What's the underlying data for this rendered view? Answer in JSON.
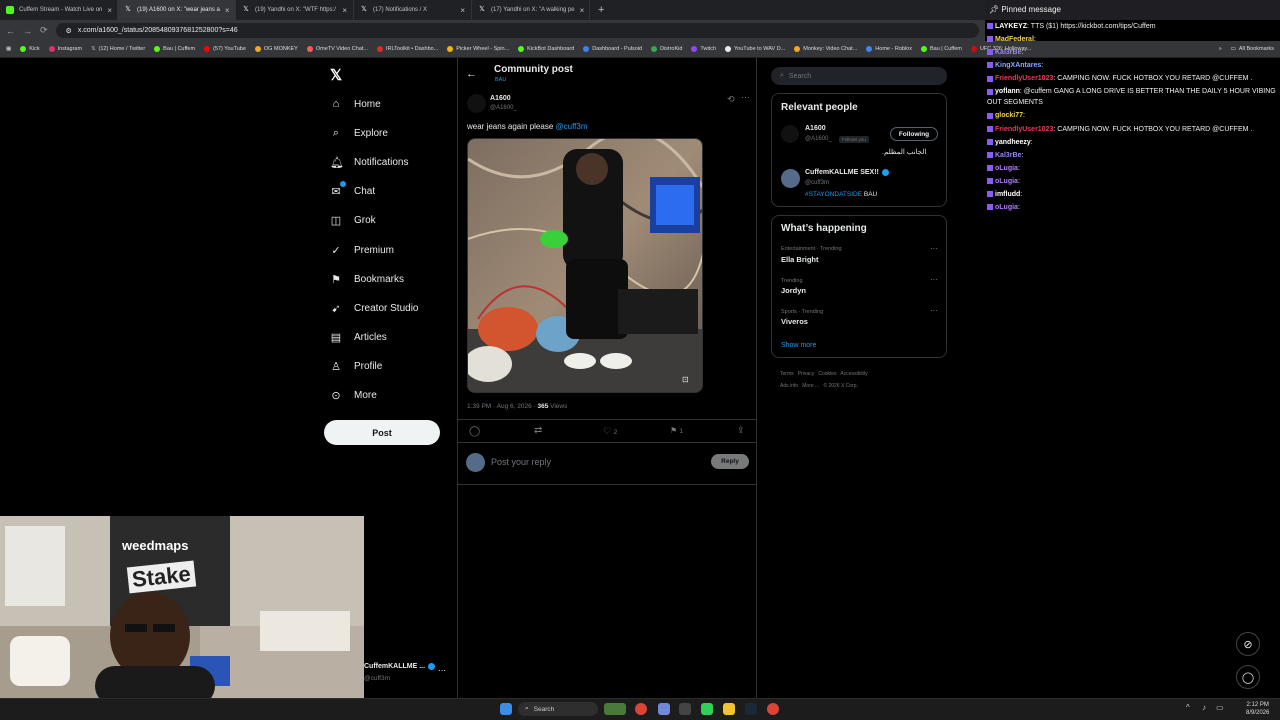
{
  "browser": {
    "tabs": [
      {
        "title": "Cuffem Stream - Watch Live on",
        "active": false
      },
      {
        "title": "(19) A1600 on X: \"wear jeans a",
        "active": true
      },
      {
        "title": "(19) Yandhi on X: \"WTF https:/",
        "active": false
      },
      {
        "title": "(17) Notifications / X",
        "active": false
      },
      {
        "title": "(17) Yandhi on X: \"A walking pe",
        "active": false
      }
    ],
    "new_tab": "+",
    "url": "x.com/a1600_/status/2085480937681252800?s=46",
    "bookmarks": [
      "Kick",
      "Instagram",
      "(12) Home / Twitter",
      "Bau | Cuffem",
      "(57) YouTube",
      "OG MONKEY",
      "OmeTV Video Chat...",
      "IRLToolkit • Dashbo...",
      "Picker Wheel - Spin...",
      "KickBot Dashboard",
      "Dashboard - Pulsoid",
      "DistroKid",
      "Twitch",
      "YouTube to WAV D...",
      "Monkey: Video Chat...",
      "Home - Roblox",
      "Bau | Cuffem",
      "UFC 326: Holloway..."
    ],
    "all_bookmarks": "All Bookmarks"
  },
  "nav": {
    "items": [
      "Home",
      "Explore",
      "Notifications",
      "Chat",
      "Grok",
      "Premium",
      "Bookmarks",
      "Creator Studio",
      "Articles",
      "Profile",
      "More"
    ],
    "post_button": "Post",
    "account_name": "CuffemKALLME ...",
    "account_handle": "@cuff3m"
  },
  "post": {
    "header_title": "Community post",
    "header_sub": "BAU",
    "author_name": "A1600",
    "author_handle": "@A1600_",
    "text": "wear jeans again please",
    "mention": "@cuff3m",
    "time": "1:39 PM · Aug 6, 2026 ·",
    "views_count": "365",
    "views_label": "Views",
    "likes": "2",
    "bookmarks": "1",
    "reply_placeholder": "Post your reply",
    "reply_button": "Reply"
  },
  "right": {
    "search_placeholder": "Search",
    "relevant_title": "Relevant people",
    "people": [
      {
        "name": "A1600",
        "handle": "@A1600_",
        "badge": "Follows you",
        "button": "Following",
        "bio": "الجانب المظلم."
      },
      {
        "name": "CuffemKALLME SEX!!",
        "handle": "@cuff3m",
        "bio_tag": "#STAYONDATSIDE",
        "bio_rest": "BAU"
      }
    ],
    "happening_title": "What’s happening",
    "trends": [
      {
        "context": "Entertainment · Trending",
        "name": "Ella Bright"
      },
      {
        "context": "Trending",
        "name": "Jordyn"
      },
      {
        "context": "Sports · Trending",
        "name": "Viveros"
      }
    ],
    "show_more": "Show more",
    "footer_links": [
      "Terms",
      "Privacy",
      "Cookies",
      "Accessibility",
      "Ads info",
      "More ...",
      "© 2026 X Corp."
    ]
  },
  "chat": {
    "pinned": "Pinned message",
    "messages": [
      {
        "user": "LAYKEYZ",
        "color": "#ffffff",
        "text": "TTS ($1) https://kickbot.com/tips/Cuffem"
      },
      {
        "user": "MadFederal",
        "color": "#f2d64b",
        "text": ""
      },
      {
        "user": "Kal3rBe",
        "color": "#9b87f5",
        "text": ""
      },
      {
        "user": "KingXAntares",
        "color": "#8ea8ff",
        "text": ""
      },
      {
        "user": "FriendlyUser1023",
        "color": "#e63b5a",
        "text": "CAMPING NOW. FUCK HOTBOX YOU RETARD @CUFFEM ."
      },
      {
        "user": "yoflann",
        "color": "#ffffff",
        "text": "@cuffem GANG A LONG DRIVE IS BETTER THAN THE DAILY 5 HOUR VIBING OUT SEGMENTS"
      },
      {
        "user": "glocki77",
        "color": "#f2d64b",
        "text": ""
      },
      {
        "user": "FriendlyUser1023",
        "color": "#e63b5a",
        "text": "CAMPING NOW. FUCK HOTBOX YOU RETARD @CUFFEM ."
      },
      {
        "user": "yandheezy",
        "color": "#ffffff",
        "text": ""
      },
      {
        "user": "Kal3rBe",
        "color": "#9b87f5",
        "text": ""
      },
      {
        "user": "oLugia",
        "color": "#b57bff",
        "text": ""
      },
      {
        "user": "oLugia",
        "color": "#b57bff",
        "text": ""
      },
      {
        "user": "imfludd",
        "color": "#ffffff",
        "text": ""
      },
      {
        "user": "oLugia",
        "color": "#b57bff",
        "text": ""
      }
    ]
  },
  "webcam": {
    "sign_top": "weedmaps",
    "sign_bottom": "Stake"
  },
  "taskbar": {
    "search": "Search",
    "time": "2:12 PM",
    "date": "8/9/2026"
  }
}
